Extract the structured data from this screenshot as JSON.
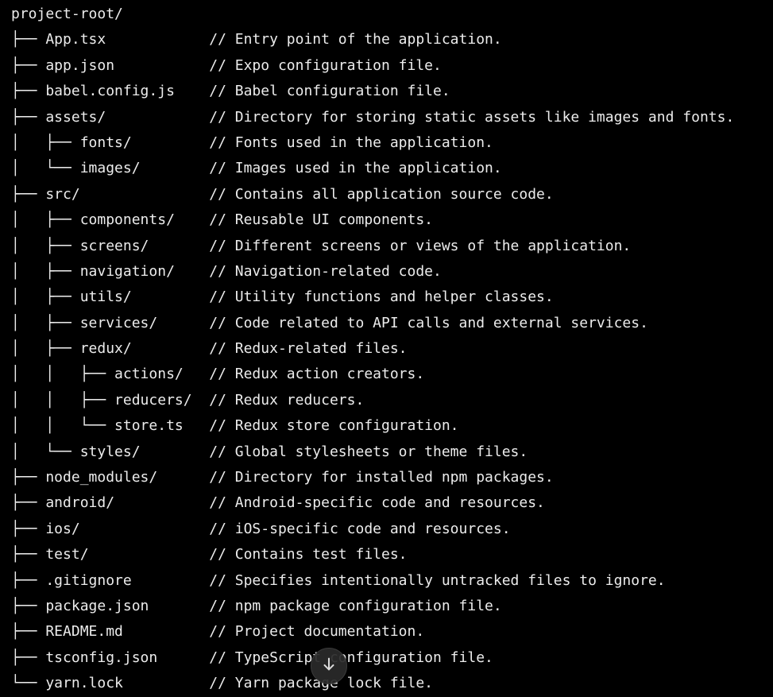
{
  "code": {
    "lines": [
      {
        "text": "project-root/"
      },
      {
        "text": "├── App.tsx            // Entry point of the application."
      },
      {
        "text": "├── app.json           // Expo configuration file."
      },
      {
        "text": "├── babel.config.js    // Babel configuration file."
      },
      {
        "text": "├── assets/            // Directory for storing static assets like images and fonts."
      },
      {
        "text": "│   ├── fonts/         // Fonts used in the application."
      },
      {
        "text": "│   └── images/        // Images used in the application."
      },
      {
        "text": "├── src/               // Contains all application source code."
      },
      {
        "text": "│   ├── components/    // Reusable UI components."
      },
      {
        "text": "│   ├── screens/       // Different screens or views of the application."
      },
      {
        "text": "│   ├── navigation/    // Navigation-related code."
      },
      {
        "text": "│   ├── utils/         // Utility functions and helper classes."
      },
      {
        "text": "│   ├── services/      // Code related to API calls and external services."
      },
      {
        "text": "│   ├── redux/         // Redux-related files."
      },
      {
        "text": "│   │   ├── actions/   // Redux action creators."
      },
      {
        "text": "│   │   ├── reducers/  // Redux reducers."
      },
      {
        "text": "│   │   └── store.ts   // Redux store configuration."
      },
      {
        "text": "│   └── styles/        // Global stylesheets or theme files."
      },
      {
        "text": "├── node_modules/      // Directory for installed npm packages."
      },
      {
        "text": "├── android/           // Android-specific code and resources."
      },
      {
        "text": "├── ios/               // iOS-specific code and resources."
      },
      {
        "text": "├── test/              // Contains test files."
      },
      {
        "text": "├── .gitignore         // Specifies intentionally untracked files to ignore."
      },
      {
        "text": "├── package.json       // npm package configuration file."
      },
      {
        "text": "├── README.md          // Project documentation."
      },
      {
        "text": "├── tsconfig.json      // TypeScript configuration file."
      },
      {
        "text": "└── yarn.lock          // Yarn package lock file."
      }
    ]
  },
  "scroll_button": {
    "icon": "arrow-down-icon"
  },
  "colors": {
    "background": "#000000",
    "text": "#ececec",
    "button_bg": "#2b2b2b"
  }
}
